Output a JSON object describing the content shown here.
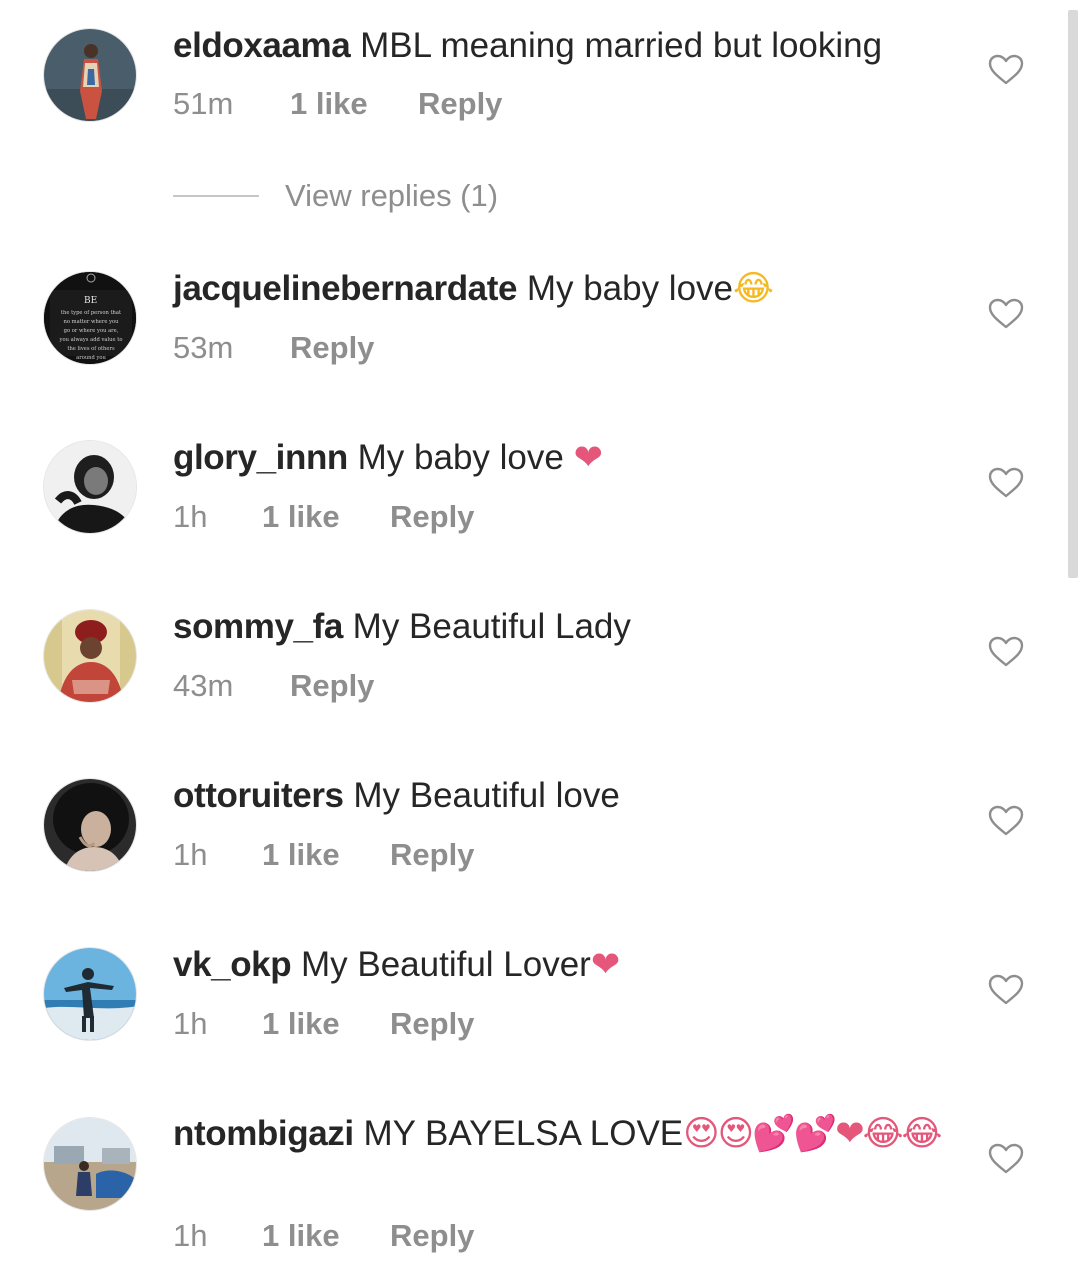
{
  "comments": [
    {
      "username": "eldoxaama",
      "text": "MBL meaning married but looking",
      "emojis": "",
      "time": "51m",
      "likes": "1 like",
      "reply": "Reply",
      "avatar_colors": [
        "#3f5565",
        "#6f7f8a",
        "#b5463a"
      ]
    },
    {
      "username": "jacquelinebernardate",
      "text": "My baby love",
      "emojis": "😂",
      "time": "53m",
      "likes": "",
      "reply": "Reply",
      "avatar_colors": [
        "#111111",
        "#2b2b2b",
        "#dddddd"
      ]
    },
    {
      "username": "glory_innn",
      "text": "My baby love",
      "emojis": "❤",
      "time": "1h",
      "likes": "1 like",
      "reply": "Reply",
      "avatar_colors": [
        "#f2f2f2",
        "#1c1c1c",
        "#6e6e6e"
      ]
    },
    {
      "username": "sommy_fa",
      "text": "My Beautiful Lady",
      "emojis": "",
      "time": "43m",
      "likes": "",
      "reply": "Reply",
      "avatar_colors": [
        "#e9dcae",
        "#b23a2f",
        "#3b2a20"
      ]
    },
    {
      "username": "ottoruiters",
      "text": "My Beautiful love",
      "emojis": "",
      "time": "1h",
      "likes": "1 like",
      "reply": "Reply",
      "avatar_colors": [
        "#2a2a2a",
        "#c8b2a0",
        "#0d0d0d"
      ]
    },
    {
      "username": "vk_okp",
      "text": "My Beautiful Lover",
      "emojis": "❤",
      "time": "1h",
      "likes": "1 like",
      "reply": "Reply",
      "avatar_colors": [
        "#5aa7d8",
        "#1e5e8c",
        "#22313f"
      ]
    },
    {
      "username": "ntombigazi",
      "text": "MY BAYELSA LOVE",
      "emojis": "😍😍💕💕❤😂😂",
      "time": "1h",
      "likes": "1 like",
      "reply": "Reply",
      "avatar_colors": [
        "#dfe6ee",
        "#7a8a99",
        "#2f6fb3"
      ]
    }
  ],
  "view_replies": "View replies (1)",
  "avatar_quote_text": [
    "BE",
    "the type of person that",
    "no matter where you",
    "go or where you are,",
    "you always add value to",
    "the lives of others",
    "around you"
  ],
  "colors": {
    "text_primary": "#262626",
    "text_secondary": "#8e8e8e",
    "heart_outline": "#8e8e8e",
    "emoji_heart": "#e5577a"
  },
  "icons": {
    "like": "heart-outline-icon"
  }
}
